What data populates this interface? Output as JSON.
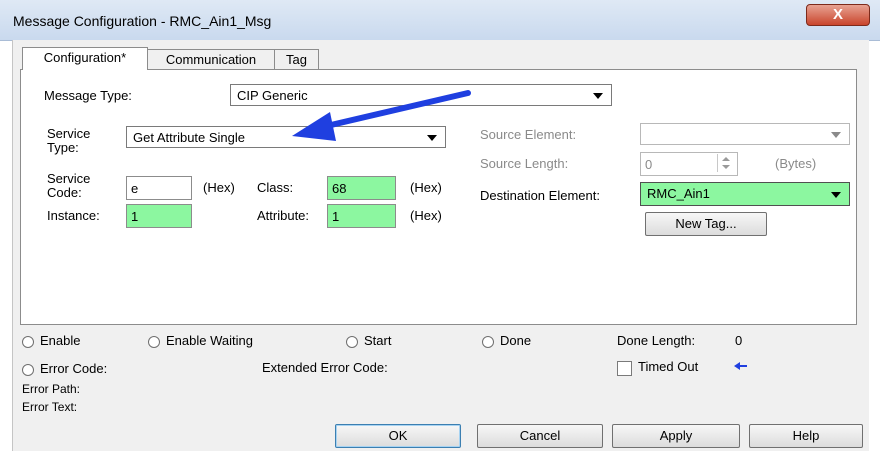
{
  "window": {
    "title": "Message Configuration - RMC_Ain1_Msg",
    "close_label": "X"
  },
  "tabs": [
    {
      "label": "Configuration*",
      "active": true
    },
    {
      "label": "Communication",
      "active": false
    },
    {
      "label": "Tag",
      "active": false
    }
  ],
  "config": {
    "message_type_label": "Message Type:",
    "message_type_value": "CIP Generic",
    "service_type_label_1": "Service",
    "service_type_label_2": "Type:",
    "service_type_value": "Get Attribute Single",
    "service_code_label_1": "Service",
    "service_code_label_2": "Code:",
    "service_code_value": "e",
    "hex_1": "(Hex)",
    "class_label": "Class:",
    "class_value": "68",
    "hex_2": "(Hex)",
    "instance_label": "Instance:",
    "instance_value": "1",
    "attribute_label": "Attribute:",
    "attribute_value": "1",
    "hex_3": "(Hex)",
    "source_element_label": "Source Element:",
    "source_element_value": "",
    "source_length_label": "Source Length:",
    "source_length_value": "0",
    "bytes_label": "(Bytes)",
    "destination_element_label": "Destination Element:",
    "destination_element_value": "RMC_Ain1",
    "new_tag_label": "New Tag..."
  },
  "status": {
    "enable": "Enable",
    "enable_waiting": "Enable Waiting",
    "start": "Start",
    "done": "Done",
    "done_length_label": "Done Length:",
    "done_length_value": "0",
    "error_code": "Error Code:",
    "extended_error_code": "Extended Error Code:",
    "timed_out": "Timed Out",
    "error_path": "Error Path:",
    "error_text": "Error Text:"
  },
  "buttons": {
    "ok": "OK",
    "cancel": "Cancel",
    "apply": "Apply",
    "help": "Help"
  },
  "colors": {
    "highlight_field": "#8cf7a0",
    "annotation_arrow": "#1f3fe0"
  }
}
